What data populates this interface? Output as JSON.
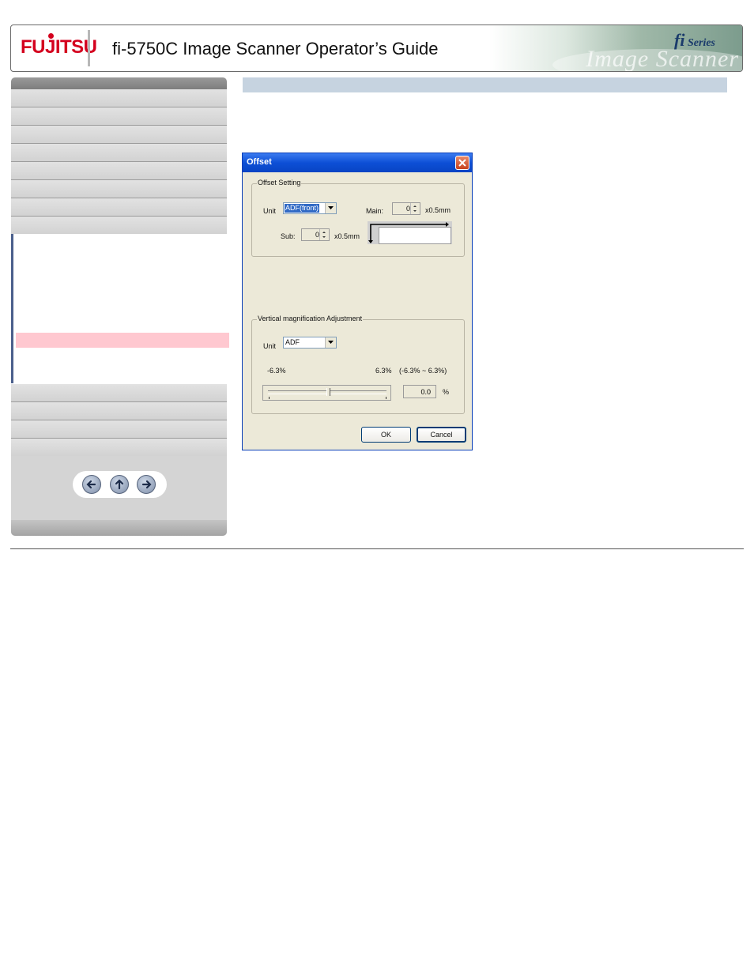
{
  "header": {
    "brand": "FUJITSU",
    "title": "fi-5750C Image Scanner Operator’s Guide",
    "series_fi": "fi",
    "series_word": "Series",
    "art_word": "Image Scanner"
  },
  "sidebar": {
    "top_items_count": 8,
    "bottom_items_count": 4,
    "nav": {
      "back": "arrow-left-icon",
      "up": "arrow-up-icon",
      "forward": "arrow-right-icon"
    }
  },
  "dialog": {
    "title": "Offset",
    "offset_group": {
      "label": "Offset Setting",
      "unit_label": "Unit",
      "unit_value": "ADF(front)",
      "main_label": "Main:",
      "main_value": "0",
      "main_unit": "x0.5mm",
      "sub_label": "Sub:",
      "sub_value": "0",
      "sub_unit": "x0.5mm"
    },
    "vmag_group": {
      "label": "Vertical magnification Adjustment",
      "unit_label": "Unit",
      "unit_value": "ADF",
      "min_label": "-6.3%",
      "max_label": "6.3%",
      "range_label": "(-6.3% ~ 6.3%)",
      "value": "0.0",
      "value_unit": "%",
      "slider_fraction": 0.5
    },
    "ok_label": "OK",
    "cancel_label": "Cancel"
  },
  "colors": {
    "brand_red": "#d4001e",
    "titlebar_blue": "#0d4fd6",
    "highlight_pink": "#ffc8d0",
    "content_bar": "#c6d3e0"
  }
}
